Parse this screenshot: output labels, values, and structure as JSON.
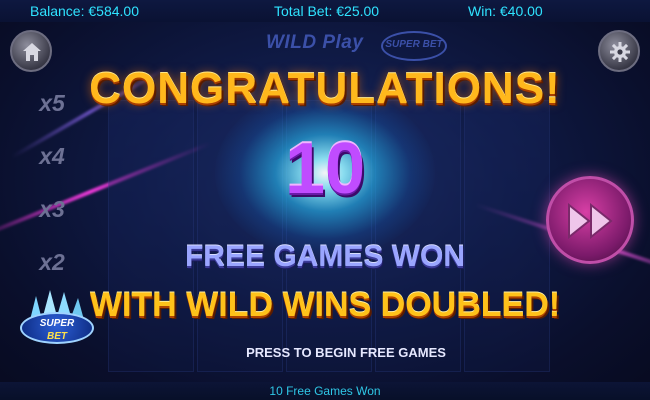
{
  "topbar": {
    "balance": "Balance: €584.00",
    "total_bet": "Total Bet: €25.00",
    "win": "Win: €40.00"
  },
  "logo": {
    "text": "WILD Play",
    "badge": "SUPER BET"
  },
  "multipliers": [
    "x5",
    "x4",
    "x3",
    "x2"
  ],
  "superbet_badge": {
    "line1": "SUPER",
    "line2": "BET"
  },
  "popup": {
    "title": "CONGRATULATIONS!",
    "count": "10",
    "line1": "FREE GAMES WON",
    "line2": "WITH WILD WINS DOUBLED!",
    "prompt": "PRESS TO BEGIN FREE GAMES"
  },
  "status_bar": "10 Free Games Won",
  "icons": [
    "home-icon",
    "gear-icon",
    "fast-forward-icon"
  ],
  "colors": {
    "accent_cyan": "#2fe3ff",
    "title_gold": "#ffb81c",
    "count_purple": "#c04cff",
    "play_magenta": "#d73fa5"
  }
}
